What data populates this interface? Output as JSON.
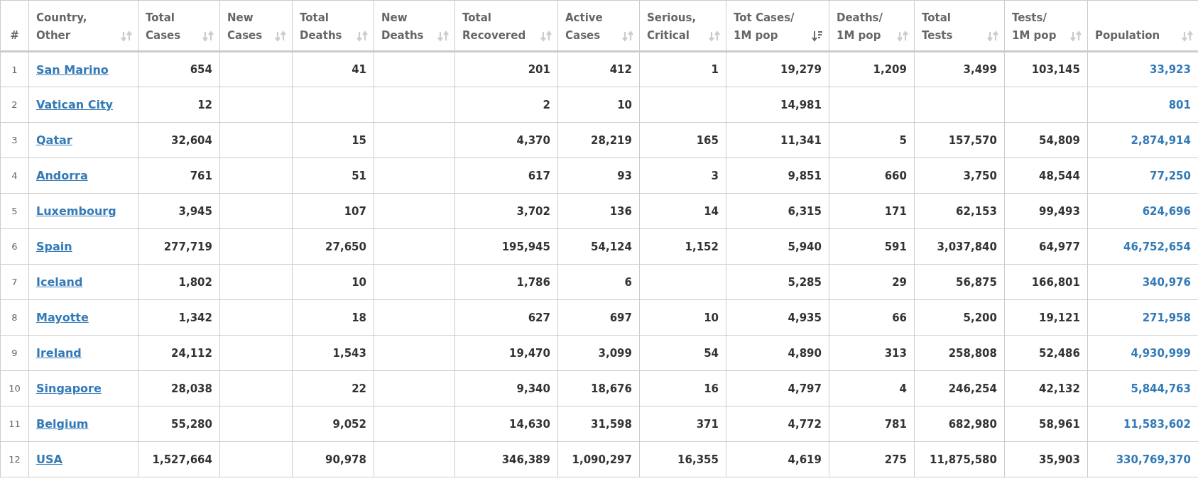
{
  "columns": [
    {
      "lines": [
        "#"
      ],
      "kind": "plain"
    },
    {
      "lines": [
        "Country,",
        "Other"
      ],
      "kind": "sortable",
      "sorted": false
    },
    {
      "lines": [
        "Total",
        "Cases"
      ],
      "kind": "sortable",
      "sorted": false
    },
    {
      "lines": [
        "New",
        "Cases"
      ],
      "kind": "sortable",
      "sorted": false
    },
    {
      "lines": [
        "Total",
        "Deaths"
      ],
      "kind": "sortable",
      "sorted": false
    },
    {
      "lines": [
        "New",
        "Deaths"
      ],
      "kind": "sortable",
      "sorted": false
    },
    {
      "lines": [
        "Total",
        "Recovered"
      ],
      "kind": "sortable",
      "sorted": false
    },
    {
      "lines": [
        "Active",
        "Cases"
      ],
      "kind": "sortable",
      "sorted": false
    },
    {
      "lines": [
        "Serious,",
        "Critical"
      ],
      "kind": "sortable",
      "sorted": false
    },
    {
      "lines": [
        "Tot Cases/",
        "1M pop"
      ],
      "kind": "sortable",
      "sorted": true
    },
    {
      "lines": [
        "Deaths/",
        "1M pop"
      ],
      "kind": "sortable",
      "sorted": false
    },
    {
      "lines": [
        "Total",
        "Tests"
      ],
      "kind": "sortable",
      "sorted": false
    },
    {
      "lines": [
        "Tests/",
        "1M pop"
      ],
      "kind": "sortable",
      "sorted": false
    },
    {
      "lines": [
        "Population"
      ],
      "kind": "sortable",
      "sorted": false
    }
  ],
  "rows": [
    {
      "rank": "1",
      "country": "San Marino",
      "cells": [
        "654",
        null,
        "41",
        null,
        "201",
        "412",
        "1",
        "19,279",
        "1,209",
        "3,499",
        "103,145"
      ],
      "population": "33,923"
    },
    {
      "rank": "2",
      "country": "Vatican City",
      "cells": [
        "12",
        null,
        null,
        null,
        "2",
        "10",
        null,
        "14,981",
        null,
        null,
        null
      ],
      "population": "801"
    },
    {
      "rank": "3",
      "country": "Qatar",
      "cells": [
        "32,604",
        null,
        "15",
        null,
        "4,370",
        "28,219",
        "165",
        "11,341",
        "5",
        "157,570",
        "54,809"
      ],
      "population": "2,874,914"
    },
    {
      "rank": "4",
      "country": "Andorra",
      "cells": [
        "761",
        null,
        "51",
        null,
        "617",
        "93",
        "3",
        "9,851",
        "660",
        "3,750",
        "48,544"
      ],
      "population": "77,250"
    },
    {
      "rank": "5",
      "country": "Luxembourg",
      "cells": [
        "3,945",
        null,
        "107",
        null,
        "3,702",
        "136",
        "14",
        "6,315",
        "171",
        "62,153",
        "99,493"
      ],
      "population": "624,696"
    },
    {
      "rank": "6",
      "country": "Spain",
      "cells": [
        "277,719",
        null,
        "27,650",
        null,
        "195,945",
        "54,124",
        "1,152",
        "5,940",
        "591",
        "3,037,840",
        "64,977"
      ],
      "population": "46,752,654"
    },
    {
      "rank": "7",
      "country": "Iceland",
      "cells": [
        "1,802",
        null,
        "10",
        null,
        "1,786",
        "6",
        null,
        "5,285",
        "29",
        "56,875",
        "166,801"
      ],
      "population": "340,976"
    },
    {
      "rank": "8",
      "country": "Mayotte",
      "cells": [
        "1,342",
        null,
        "18",
        null,
        "627",
        "697",
        "10",
        "4,935",
        "66",
        "5,200",
        "19,121"
      ],
      "population": "271,958"
    },
    {
      "rank": "9",
      "country": "Ireland",
      "cells": [
        "24,112",
        null,
        "1,543",
        null,
        "19,470",
        "3,099",
        "54",
        "4,890",
        "313",
        "258,808",
        "52,486"
      ],
      "population": "4,930,999"
    },
    {
      "rank": "10",
      "country": "Singapore",
      "cells": [
        "28,038",
        null,
        "22",
        null,
        "9,340",
        "18,676",
        "16",
        "4,797",
        "4",
        "246,254",
        "42,132"
      ],
      "population": "5,844,763"
    },
    {
      "rank": "11",
      "country": "Belgium",
      "cells": [
        "55,280",
        null,
        "9,052",
        null,
        "14,630",
        "31,598",
        "371",
        "4,772",
        "781",
        "682,980",
        "58,961"
      ],
      "population": "11,583,602"
    },
    {
      "rank": "12",
      "country": "USA",
      "cells": [
        "1,527,664",
        null,
        "90,978",
        null,
        "346,389",
        "1,090,297",
        "16,355",
        "4,619",
        "275",
        "11,875,580",
        "35,903"
      ],
      "population": "330,769,370"
    }
  ]
}
